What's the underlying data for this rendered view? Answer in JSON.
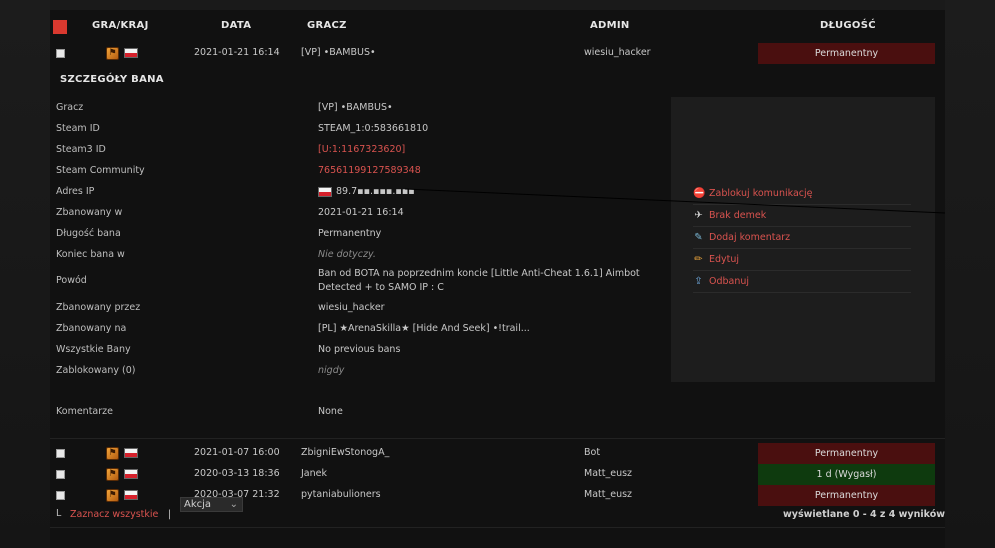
{
  "header": {
    "col_game": "GRA/KRAJ",
    "col_date": "DATA",
    "col_player": "GRACZ",
    "col_admin": "ADMIN",
    "col_length": "DŁUGOŚĆ"
  },
  "colors": {
    "accent": "#d9534f",
    "permanent_bg": "#4a0f0f",
    "expired_bg": "#0e3a0e",
    "header_square": "#d9392f"
  },
  "rows": [
    {
      "date": "2021-01-21 16:14",
      "player": "[VP] •BAMBUS•",
      "admin": "wiesiu_hacker",
      "length": "Permanentny",
      "state": "perm"
    },
    {
      "date": "2021-01-07 16:00",
      "player": "ZbigniEwStonogA_",
      "admin": "Bot",
      "length": "Permanentny",
      "state": "perm"
    },
    {
      "date": "2020-03-13 18:36",
      "player": "Janek",
      "admin": "Matt_eusz",
      "length": "1 d (Wygasł)",
      "state": "exp"
    },
    {
      "date": "2020-03-07 21:32",
      "player": "pytaniabulioners",
      "admin": "Matt_eusz",
      "length": "Permanentny",
      "state": "perm"
    }
  ],
  "details": {
    "title": "SZCZEGÓŁY BANA",
    "fields": [
      {
        "label": "Gracz",
        "value": "[VP] •BAMBUS•"
      },
      {
        "label": "Steam ID",
        "value": "STEAM_1:0:583661810"
      },
      {
        "label": "Steam3 ID",
        "value": "[U:1:1167323620]"
      },
      {
        "label": "Steam Community",
        "value": "76561199127589348"
      },
      {
        "label": "Adres IP",
        "value": "89.7▪▪.▪▪▪.▪▪▪"
      },
      {
        "label": "Zbanowany w",
        "value": "2021-01-21 16:14"
      },
      {
        "label": "Długość bana",
        "value": "Permanentny"
      },
      {
        "label": "Koniec bana w",
        "value": "Nie dotyczy."
      },
      {
        "label": "Powód",
        "value_line1": "Ban od BOTA na poprzednim koncie [Little Anti-Cheat 1.6.1] Aimbot",
        "value_line2": "Detected + to SAMO IP : C"
      },
      {
        "label": "Zbanowany przez",
        "value": "wiesiu_hacker"
      },
      {
        "label": "Zbanowany na",
        "value": "[PL] ★ArenaSkilla★ [Hide And Seek] •!trail..."
      },
      {
        "label": "Wszystkie Bany",
        "value": "No previous bans"
      },
      {
        "label": "Zablokowany (0)",
        "value": "nigdy"
      },
      {
        "label": "Komentarze",
        "value": "None"
      }
    ]
  },
  "actions": [
    {
      "icon": "block-icon",
      "label": "Zablokuj komunikację"
    },
    {
      "icon": "demo-icon",
      "label": "Brak demek"
    },
    {
      "icon": "comment-icon",
      "label": "Dodaj komentarz"
    },
    {
      "icon": "edit-icon",
      "label": "Edytuj"
    },
    {
      "icon": "unban-icon",
      "label": "Odbanuj"
    }
  ],
  "footer": {
    "select_all": "Zaznacz wszystkie",
    "separator": "|",
    "bulk_action": "Akcja",
    "result_count": "wyświetlane 0 - 4 z 4 wyników"
  }
}
